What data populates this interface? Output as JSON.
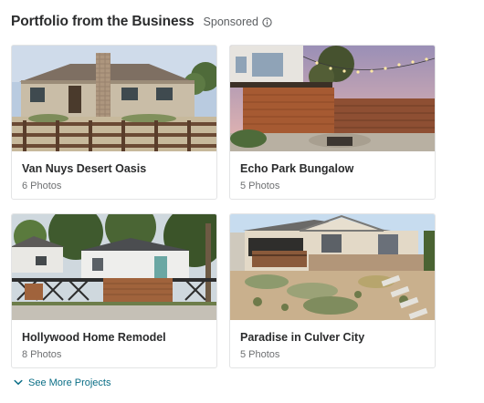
{
  "header": {
    "title": "Portfolio from the Business",
    "sponsored": "Sponsored",
    "info_icon": "info-circle-icon"
  },
  "projects": [
    {
      "title": "Van Nuys Desert Oasis",
      "photos": "6 Photos"
    },
    {
      "title": "Echo Park Bungalow",
      "photos": "5 Photos"
    },
    {
      "title": "Hollywood Home Remodel",
      "photos": "8 Photos"
    },
    {
      "title": "Paradise in Culver City",
      "photos": "5 Photos"
    }
  ],
  "footer": {
    "see_more": "See More Projects",
    "icon": "chevron-down-icon"
  },
  "colors": {
    "link": "#0a6e86",
    "title": "#2b2c2d",
    "muted": "#6e7072",
    "border": "#e3e4e5"
  }
}
